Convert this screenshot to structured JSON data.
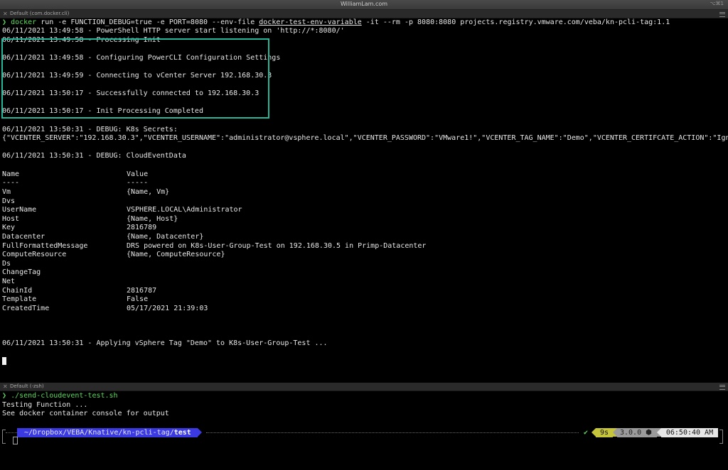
{
  "window": {
    "title": "WilliamLam.com",
    "shortcut": "⌥⌘1"
  },
  "top_pane": {
    "tab_label": "Default (com.docker.cli)",
    "command_prompt": "❯",
    "command_name": "docker",
    "command_pre": " run -e FUNCTION_DEBUG=true -e PORT=8080 --env-file ",
    "command_env_file": "docker-test-env-variable",
    "command_post": " -it --rm -p 8080:8080 projects.registry.vmware.com/veba/kn-pcli-tag:1.1",
    "lines": [
      "06/11/2021 13:49:58 - PowerShell HTTP server start listening on 'http://*:8080/'",
      "06/11/2021 13:49:58 - Processing Init",
      "06/11/2021 13:49:58 - Configuring PowerCLI Configuration Settings",
      "06/11/2021 13:49:59 - Connecting to vCenter Server 192.168.30.3",
      "06/11/2021 13:50:17 - Successfully connected to 192.168.30.3",
      "06/11/2021 13:50:17 - Init Processing Completed",
      "06/11/2021 13:50:31 - DEBUG: K8s Secrets:",
      "{\"VCENTER_SERVER\":\"192.168.30.3\",\"VCENTER_USERNAME\":\"administrator@vsphere.local\",\"VCENTER_PASSWORD\":\"VMware1!\",\"VCENTER_TAG_NAME\":\"Demo\",\"VCENTER_CERTIFCATE_ACTION\":\"Ignore\"}",
      "06/11/2021 13:50:31 - DEBUG: CloudEventData",
      "06/11/2021 13:50:31 - Applying vSphere Tag \"Demo\" to K8s-User-Group-Test ..."
    ],
    "table_header": {
      "name": "Name",
      "value": "Value"
    },
    "table_divider": {
      "name": "----",
      "value": "-----"
    },
    "table_rows": [
      {
        "name": "Vm",
        "value": "{Name, Vm}"
      },
      {
        "name": "Dvs",
        "value": ""
      },
      {
        "name": "UserName",
        "value": "VSPHERE.LOCAL\\Administrator"
      },
      {
        "name": "Host",
        "value": "{Name, Host}"
      },
      {
        "name": "Key",
        "value": "2816789"
      },
      {
        "name": "Datacenter",
        "value": "{Name, Datacenter}"
      },
      {
        "name": "FullFormattedMessage",
        "value": "DRS powered on K8s-User-Group-Test on 192.168.30.5 in Primp-Datacenter"
      },
      {
        "name": "ComputeResource",
        "value": "{Name, ComputeResource}"
      },
      {
        "name": "Ds",
        "value": ""
      },
      {
        "name": "ChangeTag",
        "value": ""
      },
      {
        "name": "Net",
        "value": ""
      },
      {
        "name": "ChainId",
        "value": "2816787"
      },
      {
        "name": "Template",
        "value": "False"
      },
      {
        "name": "CreatedTime",
        "value": "05/17/2021 21:39:03"
      }
    ]
  },
  "bottom_pane": {
    "tab_label": "Default (-zsh)",
    "command_prompt": "❯",
    "command": "./send-cloudevent-test.sh",
    "lines": [
      "Testing Function ...",
      "See docker container console for output"
    ],
    "powerline": {
      "path_prefix": "~/Dropbox/VEBA/Knative/kn-pcli-tag/",
      "path_current": "test",
      "status_check": "✔",
      "duration": "9s",
      "version": "3.0.0",
      "time": "06:50:40 AM"
    }
  },
  "colors": {
    "highlight_box": "#25b79a",
    "prompt_green": "#5fd75f",
    "path_segment_bg": "#3a3ae0",
    "duration_bg": "#c6c43a",
    "version_bg": "#9a9a9a",
    "time_bg": "#e6e6e6"
  }
}
